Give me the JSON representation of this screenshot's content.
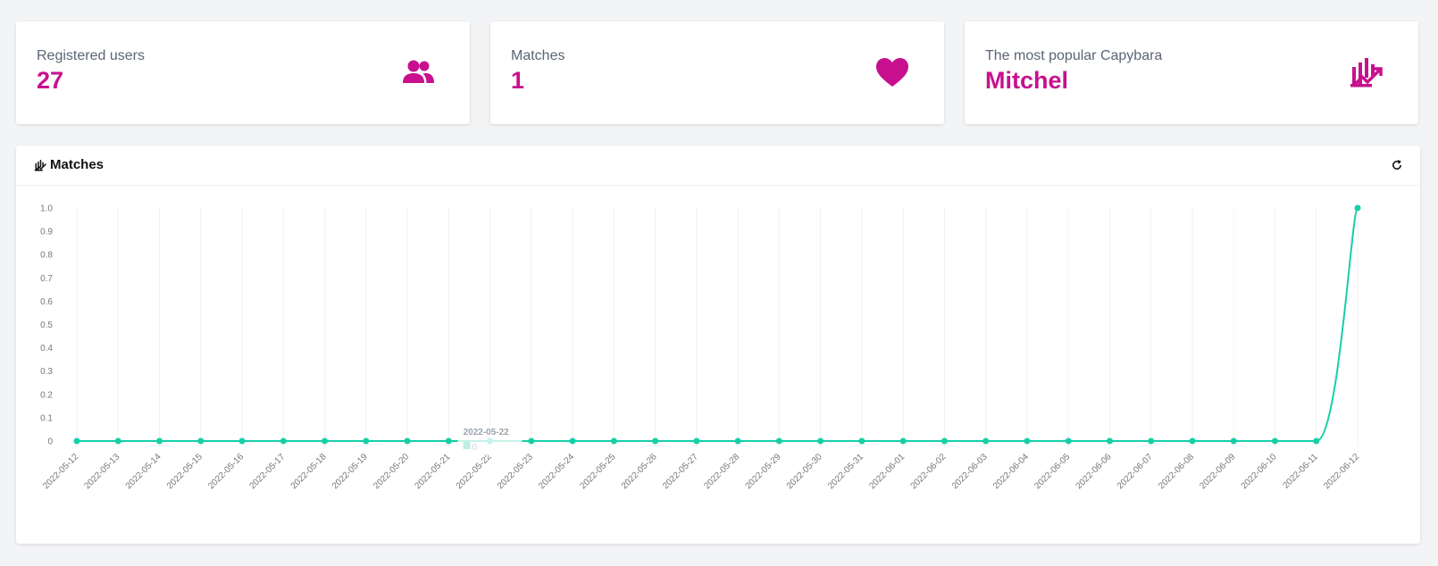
{
  "stats": [
    {
      "label": "Registered users",
      "value": "27",
      "icon": "users-icon"
    },
    {
      "label": "Matches",
      "value": "1",
      "icon": "heart-icon"
    },
    {
      "label": "The most popular Capybara",
      "value": "Mitchel",
      "icon": "chart-trend-icon"
    }
  ],
  "colors": {
    "accent": "#c8108e",
    "line": "#16cfa7"
  },
  "chart_panel": {
    "title": "Matches",
    "icon": "chart-icon",
    "refresh_icon": "refresh-icon"
  },
  "chart_data": {
    "type": "line",
    "title": "",
    "xlabel": "",
    "ylabel": "",
    "ylim": [
      0,
      1.0
    ],
    "y_ticks": [
      "0",
      "0.1",
      "0.2",
      "0.3",
      "0.4",
      "0.5",
      "0.6",
      "0.7",
      "0.8",
      "0.9",
      "1.0"
    ],
    "grid": "vertical",
    "categories": [
      "2022-05-12",
      "2022-05-13",
      "2022-05-14",
      "2022-05-15",
      "2022-05-16",
      "2022-05-17",
      "2022-05-18",
      "2022-05-19",
      "2022-05-20",
      "2022-05-21",
      "2022-05-22",
      "2022-05-23",
      "2022-05-24",
      "2022-05-25",
      "2022-05-26",
      "2022-05-27",
      "2022-05-28",
      "2022-05-29",
      "2022-05-30",
      "2022-05-31",
      "2022-06-01",
      "2022-06-02",
      "2022-06-03",
      "2022-06-04",
      "2022-06-05",
      "2022-06-06",
      "2022-06-07",
      "2022-06-08",
      "2022-06-09",
      "2022-06-10",
      "2022-06-11",
      "2022-06-12"
    ],
    "series": [
      {
        "values": [
          0,
          0,
          0,
          0,
          0,
          0,
          0,
          0,
          0,
          0,
          0,
          0,
          0,
          0,
          0,
          0,
          0,
          0,
          0,
          0,
          0,
          0,
          0,
          0,
          0,
          0,
          0,
          0,
          0,
          0,
          0,
          1
        ]
      }
    ],
    "tooltip": {
      "date": "2022-05-22",
      "value": "0"
    }
  }
}
